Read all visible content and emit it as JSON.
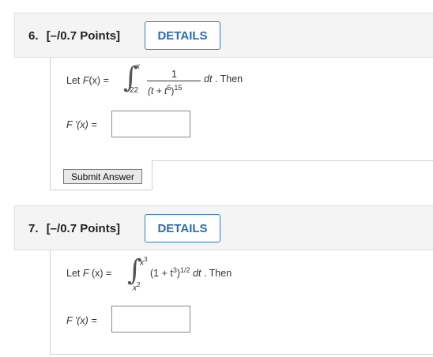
{
  "questions": [
    {
      "number": "6.",
      "points": "[–/0.7 Points]",
      "details_label": "DETAILS",
      "prompt": {
        "lhs_fn": "F",
        "lhs_var": "(x)",
        "equals": "=",
        "upper_limit": "x",
        "lower_limit": "22",
        "numerator": "1",
        "denominator_base": "(t + t",
        "denominator_inner_exp": "6",
        "denominator_close": ")",
        "denominator_outer_exp": "15",
        "differential": "dt",
        "suffix": ". Then"
      },
      "answer_label": "F '(x) =",
      "answer_value": "",
      "submit_label": "Submit Answer"
    },
    {
      "number": "7.",
      "points": "[–/0.7 Points]",
      "details_label": "DETAILS",
      "prompt": {
        "lhs_fn": "F",
        "lhs_var": "(x)",
        "equals": "=",
        "upper_limit_base": "x",
        "upper_limit_exp": "3",
        "lower_limit_base": "x",
        "lower_limit_exp": "2",
        "integrand_base": "(1 + t",
        "integrand_inner_exp": "3",
        "integrand_close": ")",
        "integrand_outer_exp": "1/2",
        "differential": "dt",
        "suffix": ". Then"
      },
      "answer_label": "F '(x) =",
      "answer_value": ""
    }
  ]
}
